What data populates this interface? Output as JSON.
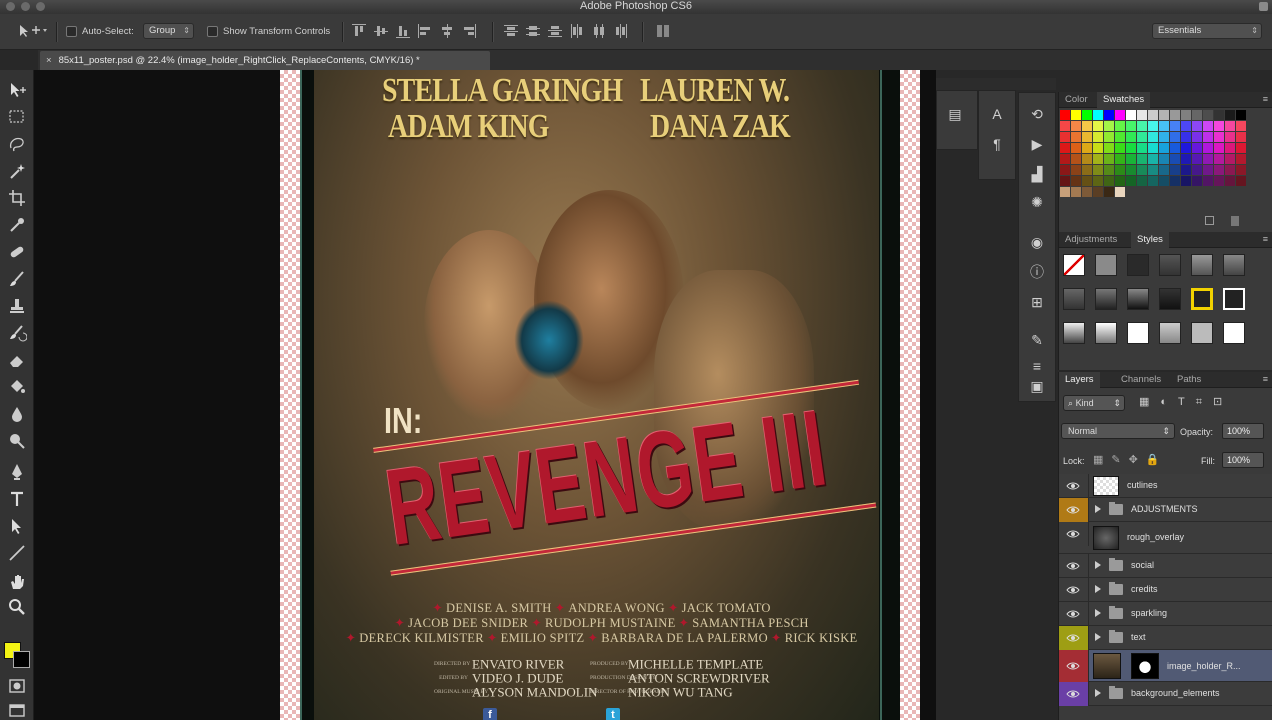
{
  "app": {
    "title": "Adobe Photoshop CS6"
  },
  "options_bar": {
    "auto_select_label": "Auto-Select:",
    "auto_select_value": "Group",
    "transform_label": "Show Transform Controls",
    "workspace": "Essentials"
  },
  "document": {
    "tab_title": "85x11_poster.psd @ 22.4% (image_holder_RightClick_ReplaceContents, CMYK/16) *"
  },
  "poster": {
    "actors": [
      "STELLA GARINGH",
      "LAUREN W.",
      "ADAM KING",
      "DANA ZAK"
    ],
    "in_label": "IN:",
    "title": "REVENGE III",
    "cast_lines": [
      [
        "DENISE A. SMITH",
        "ANDREA WONG",
        "JACK TOMATO"
      ],
      [
        "JACOB DEE SNIDER",
        "RUDOLPH MUSTAINE",
        "SAMANTHA PESCH"
      ],
      [
        "DERECK KILMISTER",
        "EMILIO SPITZ",
        "BARBARA DE LA PALERMO",
        "RICK KISKE"
      ]
    ],
    "credits": [
      {
        "label": "DIRECTED BY",
        "value": "ENVATO RIVER"
      },
      {
        "label": "PRODUCED BY",
        "value": "MICHELLE TEMPLATE"
      },
      {
        "label": "EDITED BY",
        "value": "VIDEO J. DUDE"
      },
      {
        "label": "PRODUCTION DESIGN BY",
        "value": "ANTON SCREWDRIVER"
      },
      {
        "label": "ORIGINAL MUSIC BY",
        "value": "ALYSON MANDOLIN"
      },
      {
        "label": "DIRECTOR OF PHOTOGRAPHY",
        "value": "NIKON WU TANG"
      }
    ],
    "social": [
      "f",
      "t"
    ]
  },
  "panels": {
    "color_tabs": [
      "Color",
      "Swatches"
    ],
    "color_active": "Swatches",
    "adjust_tabs": [
      "Adjustments",
      "Styles"
    ],
    "adjust_active": "Styles",
    "layer_tabs": [
      "Layers",
      "Channels",
      "Paths"
    ],
    "layer_active": "Layers",
    "kind_filter": "Kind",
    "blend_mode": "Normal",
    "opacity_label": "Opacity:",
    "opacity_value": "100%",
    "lock_label": "Lock:",
    "fill_label": "Fill:",
    "fill_value": "100%"
  },
  "layers": [
    {
      "name": "cutlines",
      "type": "layer",
      "tag_color": ""
    },
    {
      "name": "ADJUSTMENTS",
      "type": "group",
      "tag_color": "#b07a16"
    },
    {
      "name": "rough_overlay",
      "type": "layer",
      "tag_color": ""
    },
    {
      "name": "social",
      "type": "group",
      "tag_color": ""
    },
    {
      "name": "credits",
      "type": "group",
      "tag_color": ""
    },
    {
      "name": "sparkling",
      "type": "group",
      "tag_color": ""
    },
    {
      "name": "text",
      "type": "group",
      "tag_color": "#9e9e14"
    },
    {
      "name": "image_holder_R...",
      "type": "smart",
      "tag_color": "#a42d34",
      "selected": true
    },
    {
      "name": "background_elements",
      "type": "group",
      "tag_color": "#6a3fa6"
    }
  ],
  "colors": {
    "foreground": "#f4f414",
    "background": "#000000",
    "title_red": "#b0182c",
    "actor_gold": "#e8cf7a"
  },
  "icons": [
    "move-tool-icon",
    "marquee-icon",
    "lasso-icon",
    "magic-wand-icon",
    "crop-icon",
    "eyedropper-icon",
    "healing-brush-icon",
    "brush-icon",
    "clone-stamp-icon",
    "history-brush-icon",
    "eraser-icon",
    "paint-bucket-icon",
    "blur-icon",
    "dodge-icon",
    "pen-icon",
    "type-icon",
    "path-selection-icon",
    "line-icon",
    "hand-icon",
    "zoom-icon",
    "eye-icon",
    "folder-icon"
  ]
}
